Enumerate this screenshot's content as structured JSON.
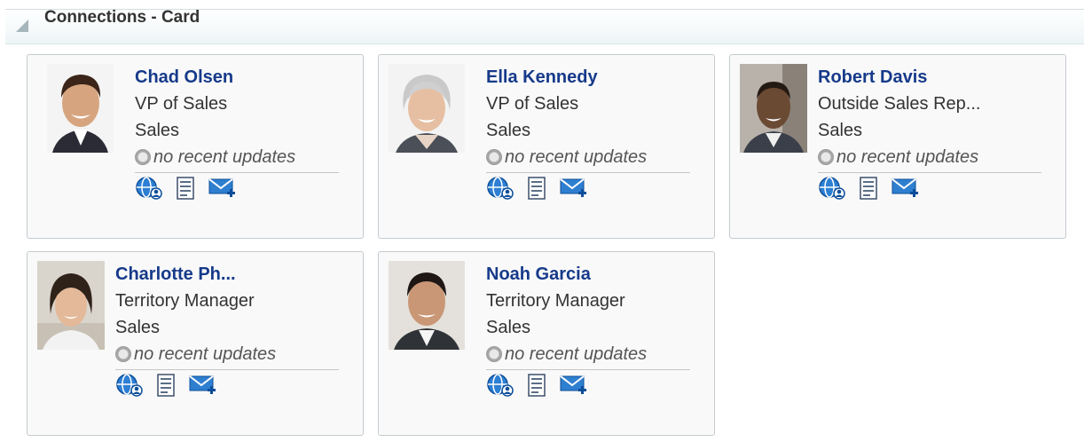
{
  "panel": {
    "title": "Connections - Card"
  },
  "cards": [
    {
      "name": "Chad Olsen",
      "title": "VP of Sales",
      "dept": "Sales",
      "status": "no recent updates"
    },
    {
      "name": "Ella Kennedy",
      "title": "VP of Sales",
      "dept": "Sales",
      "status": "no recent updates"
    },
    {
      "name": "Robert Davis",
      "title": "Outside Sales Rep...",
      "dept": "Sales",
      "status": "no recent updates"
    },
    {
      "name": "Charlotte Ph...",
      "title": "Territory Manager",
      "dept": "Sales",
      "status": "no recent updates"
    },
    {
      "name": "Noah Garcia",
      "title": "Territory Manager",
      "dept": "Sales",
      "status": "no recent updates"
    }
  ],
  "icons": {
    "disclosure": "collapse-triangle-icon",
    "status": "presence-offline-icon",
    "actions": [
      "network-connection-icon",
      "profile-card-icon",
      "send-message-icon"
    ]
  },
  "colors": {
    "name_link": "#163a8a",
    "accent": "#1a5fb4",
    "card_border": "#c5cbd0"
  }
}
